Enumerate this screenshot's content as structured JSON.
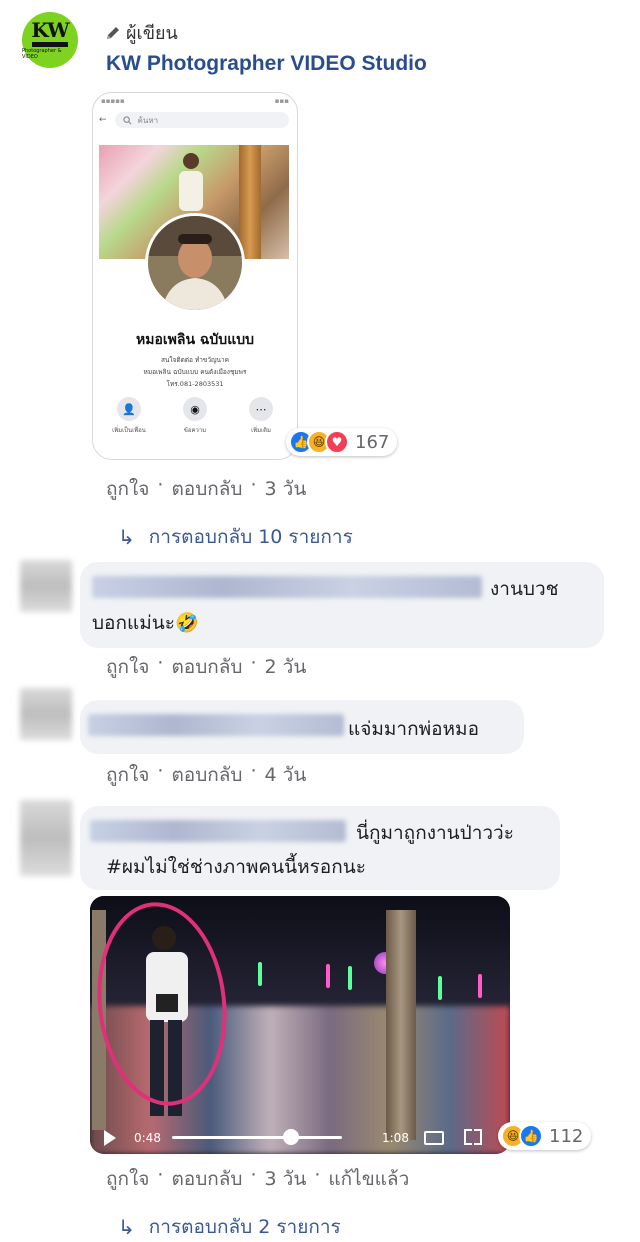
{
  "post": {
    "author_badge": "ผู้เขียน",
    "page_name": "KW Photographer VIDEO Studio",
    "avatar_text": "KW",
    "avatar_subtext": "Photographer & VIDEO",
    "screenshot": {
      "search_placeholder": "ค้นหา",
      "profile_name": "หมอเพลิน ฉบับแบบ",
      "line1": "สนใจติดต่อ ทำขวัญนาค",
      "line2": "หมอเพลิน ฉบับแบบ คนดังเมืองชุมพร",
      "line3": "โทร.081-2803531",
      "actions": [
        "เพิ่มเป็นเพื่อน",
        "ข้อความ",
        "เพิ่มเติม"
      ]
    },
    "reactions": {
      "icons": [
        "like-icon",
        "haha-icon",
        "love-icon"
      ],
      "count": "167"
    },
    "meta": {
      "like": "ถูกใจ",
      "reply": "ตอบกลับ",
      "time": "3 วัน",
      "sep": "·"
    },
    "replies_link": "การตอบกลับ 10 รายการ"
  },
  "comments": [
    {
      "text_line1": "งานบวช",
      "text_line2": "บอกแม่นะ🤣",
      "meta": {
        "like": "ถูกใจ",
        "reply": "ตอบกลับ",
        "time": "2 วัน"
      }
    },
    {
      "text_line1": "แจ่มมากพ่อหมอ",
      "meta": {
        "like": "ถูกใจ",
        "reply": "ตอบกลับ",
        "time": "4 วัน"
      }
    },
    {
      "text_line1": "นี่กูมาถูกงานป่าวว่ะ",
      "text_line2": "#ผมไม่ใช่ช่างภาพคนนี้หรอกนะ",
      "video": {
        "current_time": "0:48",
        "duration": "1:08",
        "progress": 0.7
      },
      "reactions": {
        "icons": [
          "haha-icon",
          "like-icon"
        ],
        "count": "112"
      },
      "meta": {
        "like": "ถูกใจ",
        "reply": "ตอบกลับ",
        "time": "3 วัน",
        "edited": "แก้ไขแล้ว"
      },
      "replies_link": "การตอบกลับ 2 รายการ"
    }
  ]
}
